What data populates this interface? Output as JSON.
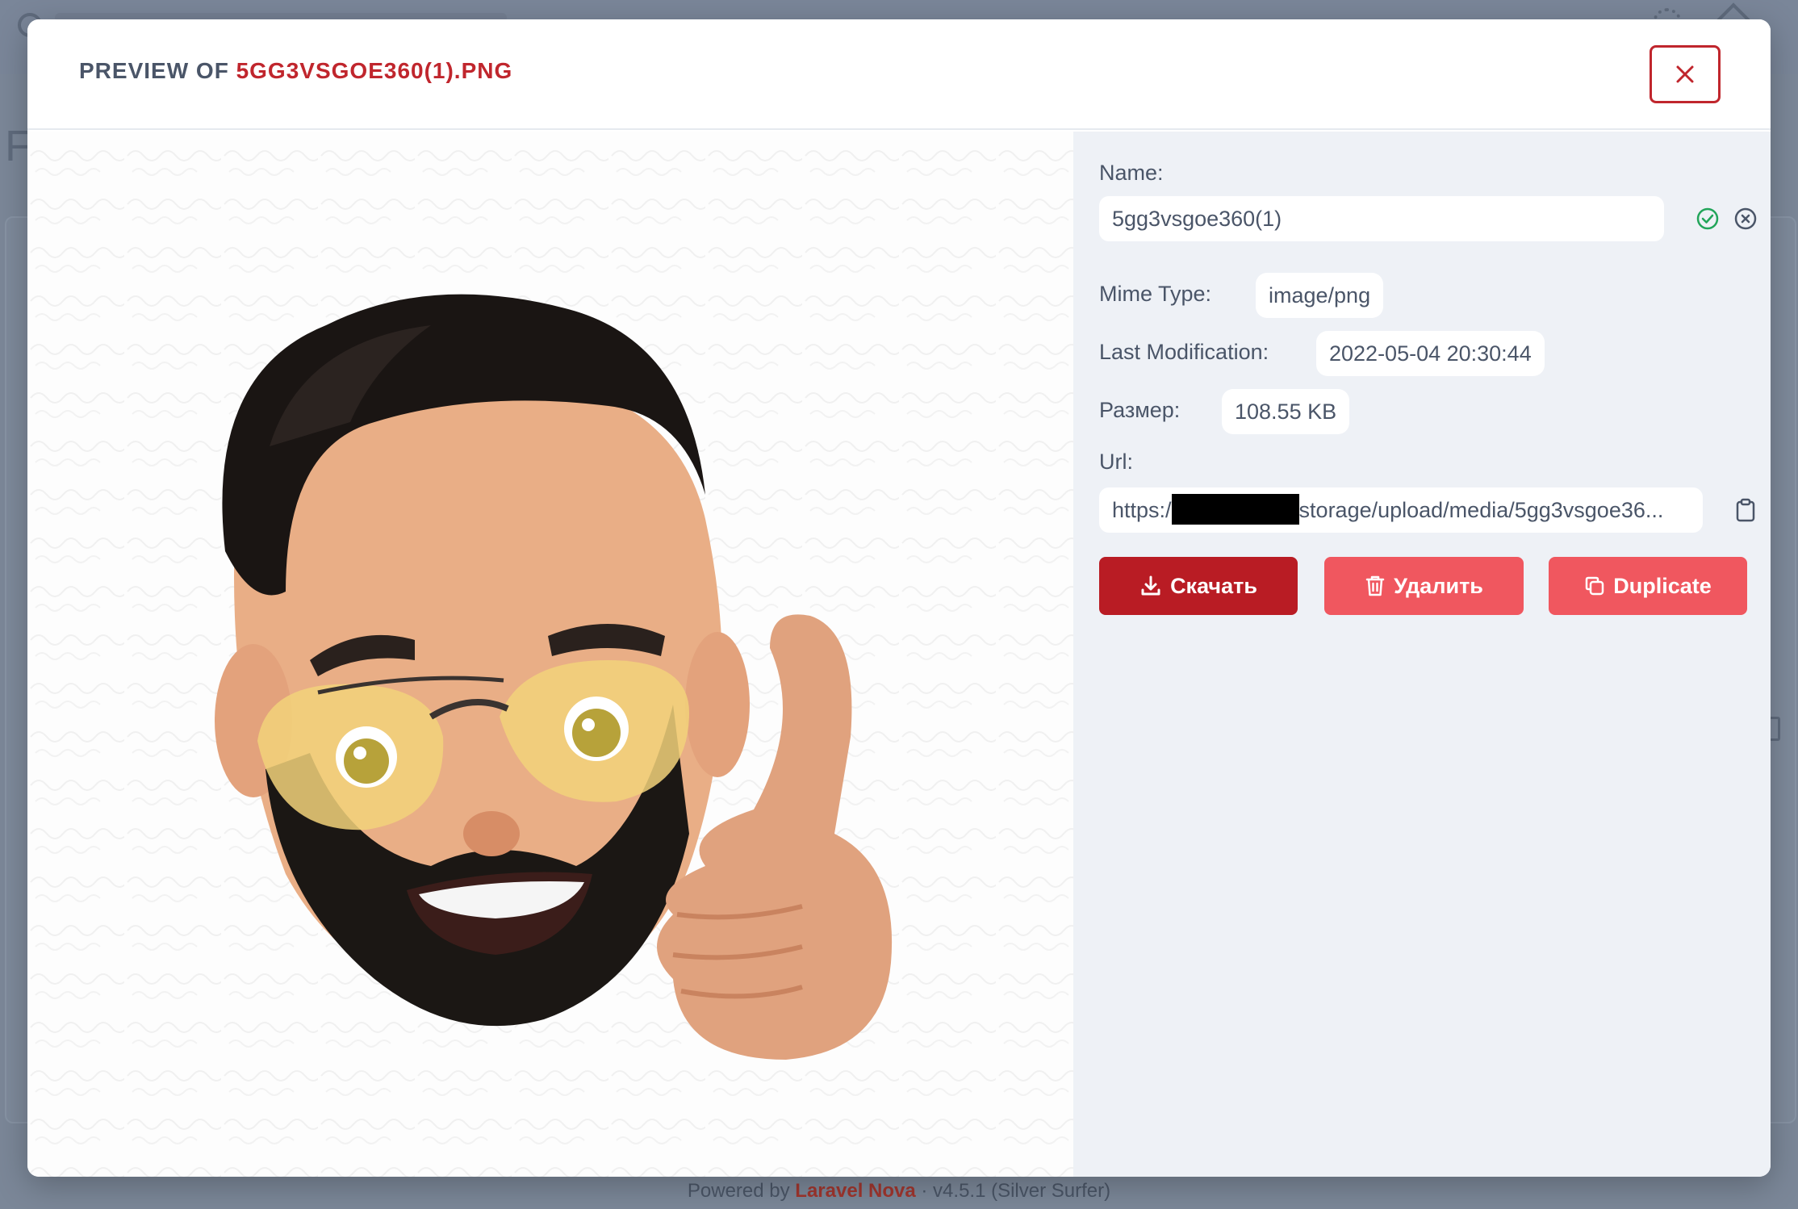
{
  "background": {
    "footer": {
      "prefix": "Powered by",
      "brand": "Laravel Nova",
      "suffix": "· v4.5.1 (Silver Surfer)"
    },
    "heading_letter": "F"
  },
  "modal": {
    "title_prefix": "PREVIEW OF",
    "title_filename": "5GG3VSGOE360(1).PNG",
    "close_icon": "close-icon"
  },
  "details": {
    "name_label": "Name:",
    "name_value": "5gg3vsgoe360(1)",
    "mime_label": "Mime Type:",
    "mime_value": "image/png",
    "modified_label": "Last Modification:",
    "modified_value": "2022-05-04 20:30:44",
    "size_label": "Размер:",
    "size_value": "108.55 KB",
    "url_label": "Url:",
    "url_prefix": "https:/",
    "url_suffix": "storage/upload/media/5gg3vsgoe36..."
  },
  "actions": {
    "download": "Скачать",
    "delete": "Удалить",
    "duplicate": "Duplicate"
  },
  "colors": {
    "accent": "#c0262d",
    "primary_button": "#b91c24",
    "secondary_button": "#f0575f",
    "confirm": "#22a55a"
  }
}
